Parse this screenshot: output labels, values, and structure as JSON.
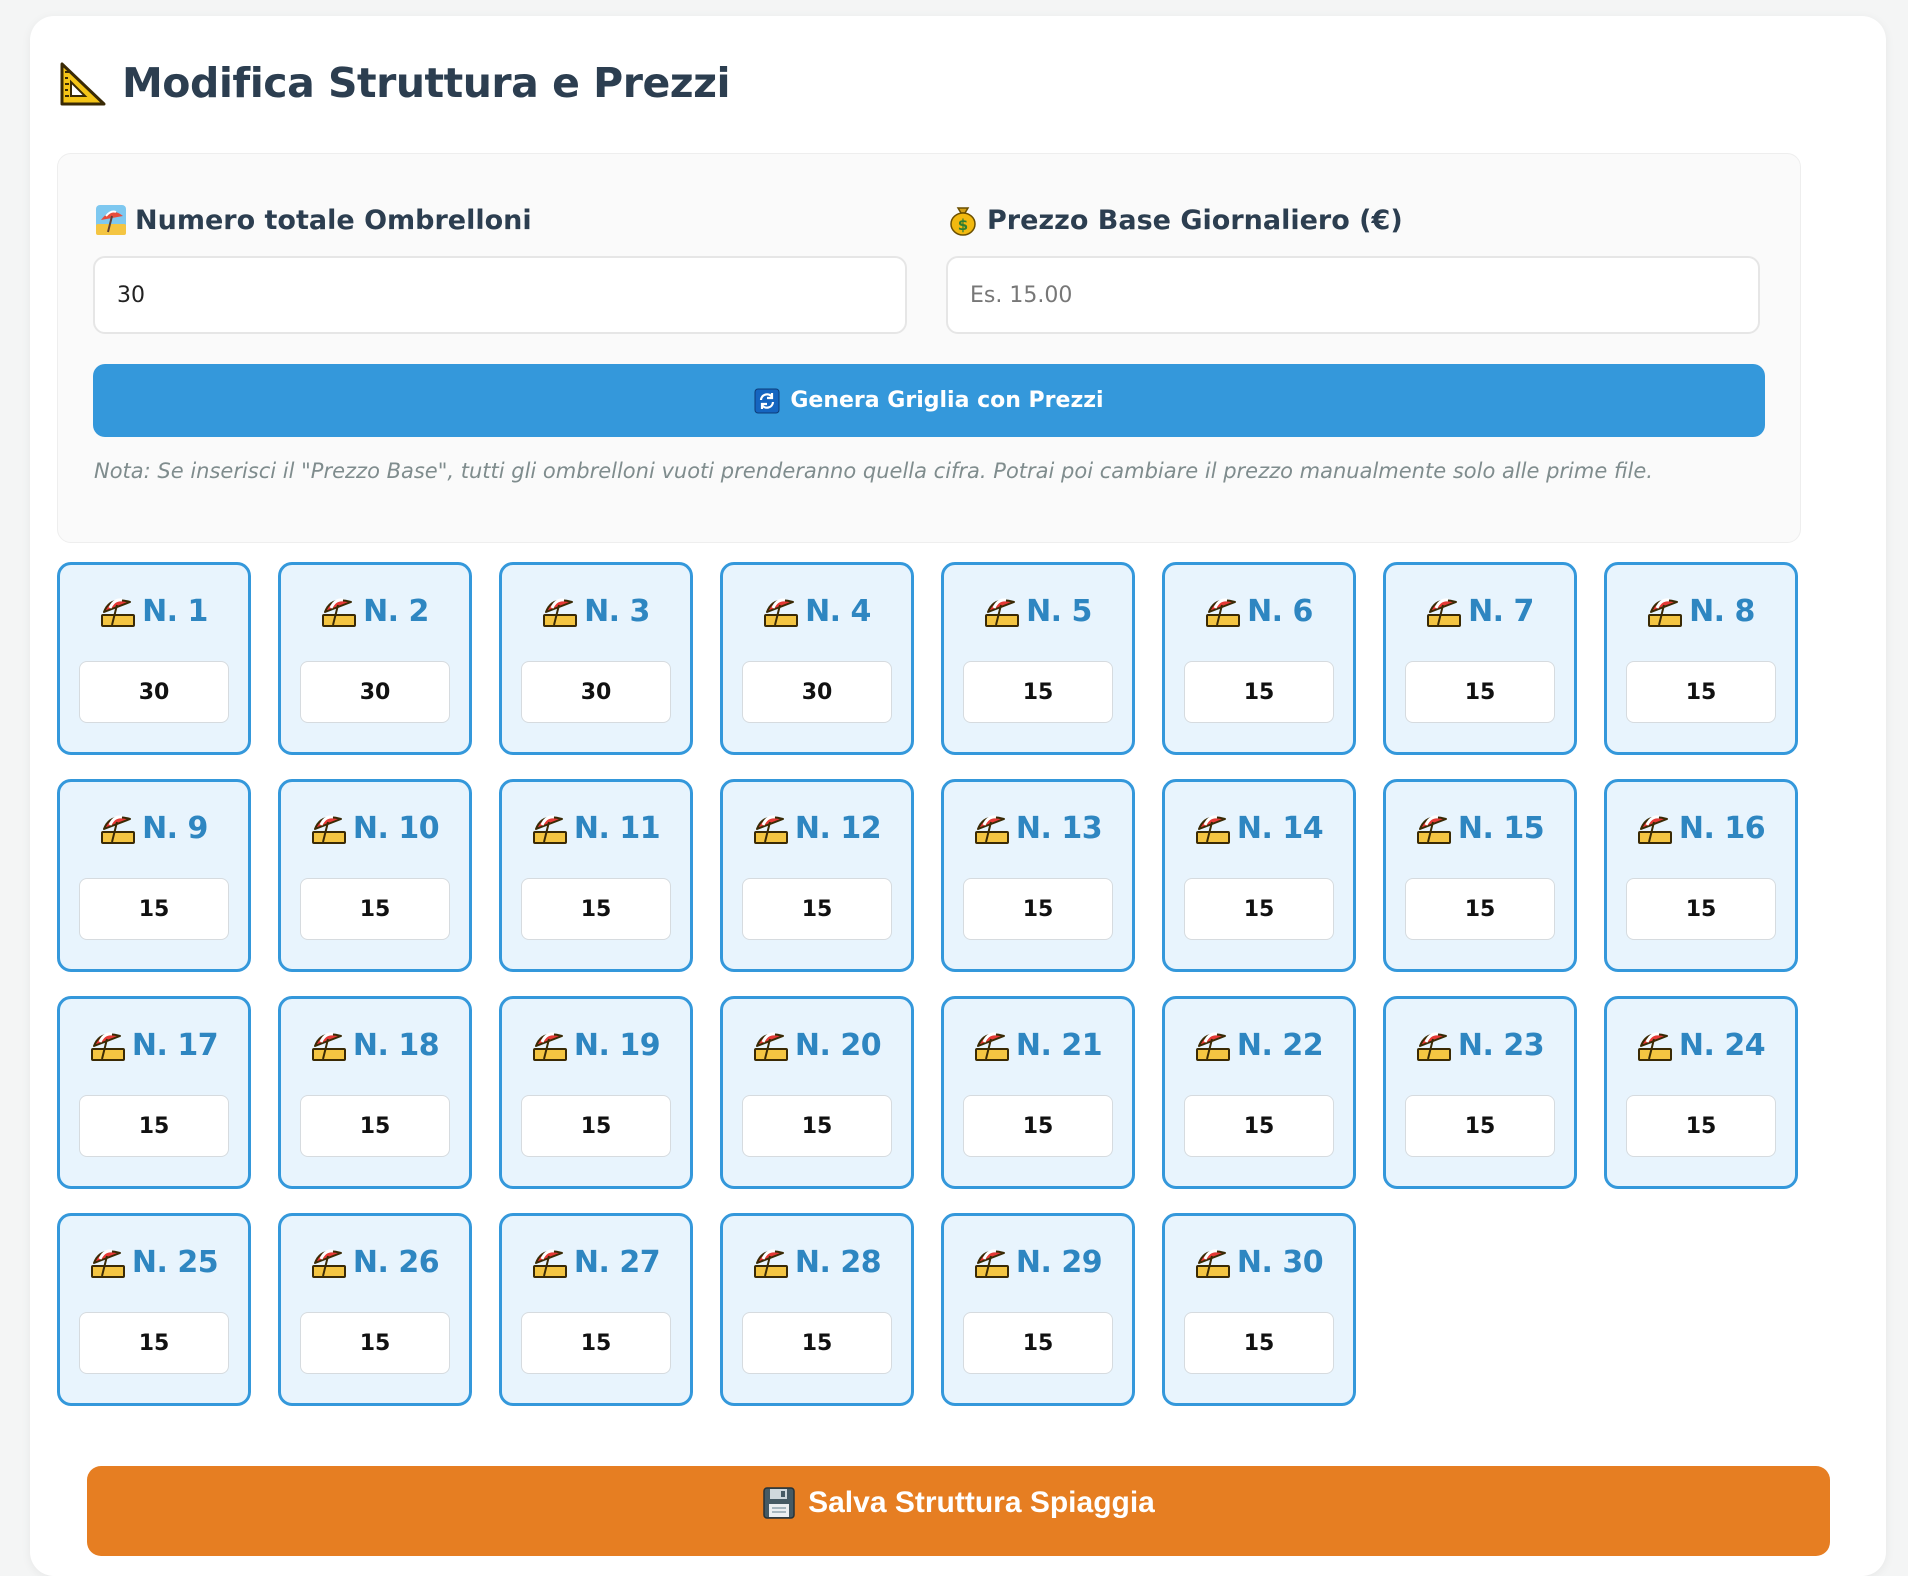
{
  "page": {
    "title": "Modifica Struttura e Prezzi",
    "title_icon": "triangular-ruler-icon"
  },
  "settings": {
    "count_label": "Numero totale Ombrelloni",
    "count_icon": "beach-icon",
    "count_value": "30",
    "price_label": "Prezzo Base Giornaliero (€)",
    "price_icon": "money-bag-icon",
    "price_value": "",
    "price_placeholder": "Es. 15.00",
    "generate_label": "Genera Griglia con Prezzi",
    "generate_icon": "refresh-icon",
    "note": "Nota: Se inserisci il \"Prezzo Base\", tutti gli ombrelloni vuoti prenderanno quella cifra. Potrai poi cambiare il prezzo manualmente solo alle prime file."
  },
  "umbrellas": [
    {
      "label": "N. 1",
      "price": "30"
    },
    {
      "label": "N. 2",
      "price": "30"
    },
    {
      "label": "N. 3",
      "price": "30"
    },
    {
      "label": "N. 4",
      "price": "30"
    },
    {
      "label": "N. 5",
      "price": "15"
    },
    {
      "label": "N. 6",
      "price": "15"
    },
    {
      "label": "N. 7",
      "price": "15"
    },
    {
      "label": "N. 8",
      "price": "15"
    },
    {
      "label": "N. 9",
      "price": "15"
    },
    {
      "label": "N. 10",
      "price": "15"
    },
    {
      "label": "N. 11",
      "price": "15"
    },
    {
      "label": "N. 12",
      "price": "15"
    },
    {
      "label": "N. 13",
      "price": "15"
    },
    {
      "label": "N. 14",
      "price": "15"
    },
    {
      "label": "N. 15",
      "price": "15"
    },
    {
      "label": "N. 16",
      "price": "15"
    },
    {
      "label": "N. 17",
      "price": "15"
    },
    {
      "label": "N. 18",
      "price": "15"
    },
    {
      "label": "N. 19",
      "price": "15"
    },
    {
      "label": "N. 20",
      "price": "15"
    },
    {
      "label": "N. 21",
      "price": "15"
    },
    {
      "label": "N. 22",
      "price": "15"
    },
    {
      "label": "N. 23",
      "price": "15"
    },
    {
      "label": "N. 24",
      "price": "15"
    },
    {
      "label": "N. 25",
      "price": "15"
    },
    {
      "label": "N. 26",
      "price": "15"
    },
    {
      "label": "N. 27",
      "price": "15"
    },
    {
      "label": "N. 28",
      "price": "15"
    },
    {
      "label": "N. 29",
      "price": "15"
    },
    {
      "label": "N. 30",
      "price": "15"
    }
  ],
  "umbrella_icon": "beach-umbrella-icon",
  "save": {
    "label": "Salva Struttura Spiaggia",
    "icon": "floppy-disk-icon"
  },
  "colors": {
    "primary": "#3498db",
    "accent": "#e67e22",
    "card_bg": "#e8f4fd",
    "title": "#2c3e50"
  }
}
